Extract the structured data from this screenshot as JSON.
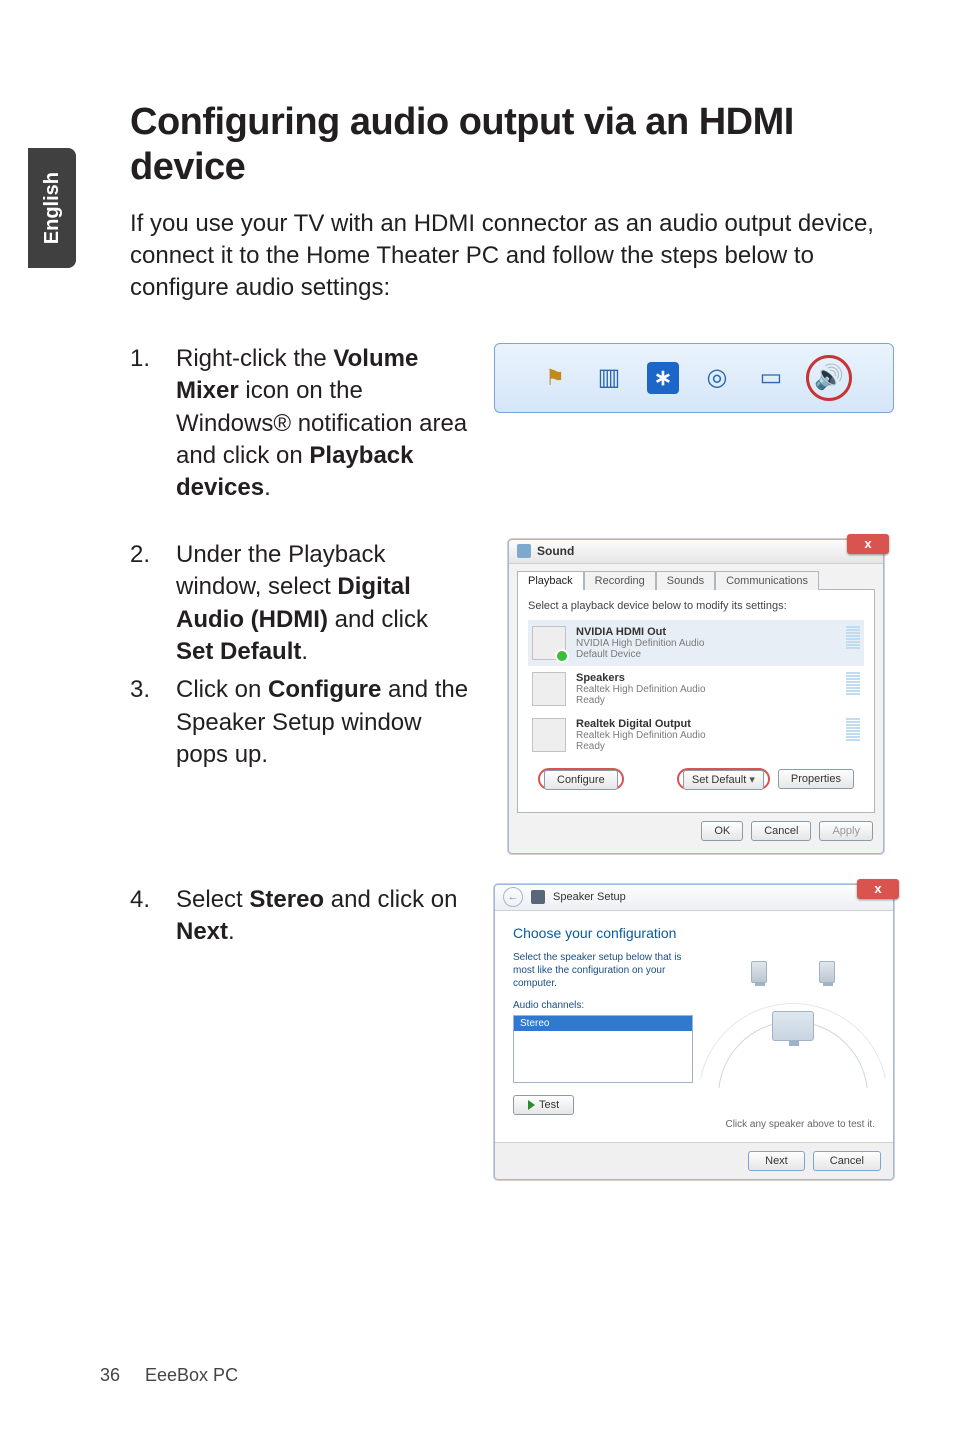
{
  "side_tab": {
    "label": "English"
  },
  "heading": "Configuring audio output via an HDMI device",
  "intro": "If you use your TV with an HDMI connector as an audio output device, connect it to the Home Theater PC and follow the steps below to configure audio settings:",
  "steps": {
    "s1": {
      "num": "1.",
      "pre": "Right-click the ",
      "b1": "Volume Mixer",
      "mid": " icon on the Windows® notification area and click on ",
      "b2": "Playback devices",
      "post": "."
    },
    "s2": {
      "num": "2.",
      "pre": "Under the Playback window, select ",
      "b1": "Digital Audio (HDMI)",
      "mid": " and click ",
      "b2": "Set Default",
      "post": "."
    },
    "s3": {
      "num": "3.",
      "pre": "Click on ",
      "b1": "Configure",
      "post": " and the Speaker Setup window pops up."
    },
    "s4": {
      "num": "4.",
      "pre": "Select ",
      "b1": "Stereo",
      "mid": " and click on ",
      "b2": "Next",
      "post": "."
    }
  },
  "sound_dialog": {
    "title": "Sound",
    "close": "x",
    "tabs": {
      "t1": "Playback",
      "t2": "Recording",
      "t3": "Sounds",
      "t4": "Communications"
    },
    "instruct": "Select a playback device below to modify its settings:",
    "devices": [
      {
        "name": "NVIDIA HDMI Out",
        "detail": "NVIDIA High Definition Audio",
        "status": "Default Device"
      },
      {
        "name": "Speakers",
        "detail": "Realtek High Definition Audio",
        "status": "Ready"
      },
      {
        "name": "Realtek Digital Output",
        "detail": "Realtek High Definition Audio",
        "status": "Ready"
      }
    ],
    "buttons": {
      "configure": "Configure",
      "setdefault": "Set Default",
      "properties": "Properties",
      "ok": "OK",
      "cancel": "Cancel",
      "apply": "Apply"
    }
  },
  "speaker_dialog": {
    "title": "Speaker Setup",
    "close": "x",
    "heading": "Choose your configuration",
    "sub": "Select the speaker setup below that is most like the configuration on your computer.",
    "channels_label": "Audio channels:",
    "option": "Stereo",
    "test": "Test",
    "hint": "Click any speaker above to test it.",
    "next": "Next",
    "cancel": "Cancel"
  },
  "footer": {
    "page": "36",
    "title": "EeeBox PC"
  }
}
